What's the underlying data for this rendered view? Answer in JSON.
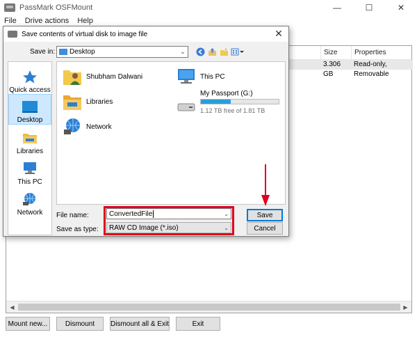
{
  "main_window": {
    "title": "PassMark OSFMount",
    "controls": {
      "minimize": "—",
      "maximize": "☐",
      "close": "✕"
    }
  },
  "menu": [
    "File",
    "Drive actions",
    "Help"
  ],
  "list": {
    "columns": [
      {
        "label": "Size"
      },
      {
        "label": "Properties"
      }
    ],
    "row": {
      "size": "3.306 GB",
      "properties": "Read-only, Removable"
    }
  },
  "bottom_buttons": {
    "mount_new": "Mount new...",
    "dismount": "Dismount",
    "dismount_all_exit": "Dismount all & Exit",
    "exit": "Exit"
  },
  "dialog": {
    "title": "Save contents of virtual disk to image file",
    "close": "✕",
    "save_in_label": "Save in:",
    "save_in_value": "Desktop",
    "places": [
      {
        "label": "Quick access",
        "icon": "star-icon"
      },
      {
        "label": "Desktop",
        "icon": "desktop-icon",
        "active": true
      },
      {
        "label": "Libraries",
        "icon": "libraries-icon"
      },
      {
        "label": "This PC",
        "icon": "this-pc-icon"
      },
      {
        "label": "Network",
        "icon": "network-icon"
      }
    ],
    "items": [
      {
        "label": "Shubham Dalwani",
        "icon": "user-folder-icon"
      },
      {
        "label": "This PC",
        "icon": "this-pc-icon"
      },
      {
        "label": "Libraries",
        "icon": "libraries-icon"
      },
      {
        "label": "My Passport (G:)",
        "icon": "drive-icon",
        "free_text": "1.12 TB free of 1.81 TB",
        "used_fraction": 0.38
      },
      {
        "label": "Network",
        "icon": "network-icon"
      }
    ],
    "file_name_label": "File name:",
    "file_name_value": "ConvertedFile",
    "save_as_type_label": "Save as type:",
    "save_as_type_value": "RAW CD Image (*.iso)",
    "save_button": "Save",
    "cancel_button": "Cancel"
  },
  "colors": {
    "highlight": "#e0001b",
    "accent": "#0078d7",
    "drive_bar": "#26a0da"
  }
}
